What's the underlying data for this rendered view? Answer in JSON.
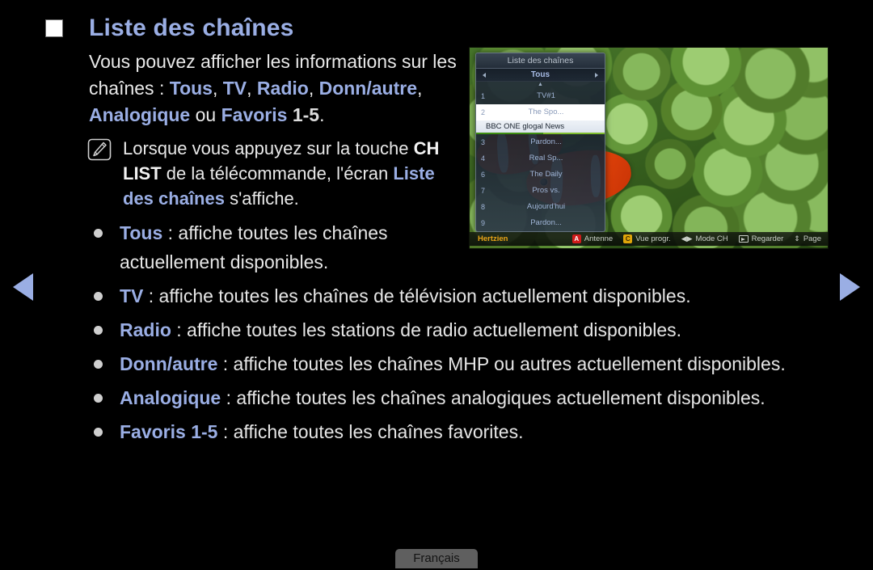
{
  "page": {
    "title": "Liste des chaînes",
    "intro": {
      "lead": "Vous pouvez afficher les informations sur les chaînes : ",
      "kw_tous": "Tous",
      "sep1": ", ",
      "kw_tv": "TV",
      "sep2": ", ",
      "kw_radio": "Radio",
      "sep3": ", ",
      "kw_donn": "Donn/autre",
      "sep4": ", ",
      "kw_analog": "Analogique",
      "sep5": " ou ",
      "kw_favoris": "Favoris",
      "kw_favoris_range": " 1-5",
      "end": "."
    },
    "note": {
      "icon": "note-pen-icon",
      "part1": "Lorsque vous appuyez sur la touche ",
      "bold1": "CH LIST",
      "part2": " de la télécommande, l'écran ",
      "bold2": "Liste des chaînes",
      "part3": " s'affiche."
    },
    "bullets": [
      {
        "term": "Tous",
        "desc": " : affiche toutes les chaînes actuellement disponibles.",
        "narrow": true
      },
      {
        "term": "TV",
        "desc": " : affiche toutes les chaînes de télévision actuellement disponibles.",
        "narrow": false
      },
      {
        "term": "Radio",
        "desc": " : affiche toutes les stations de radio actuellement disponibles.",
        "narrow": false
      },
      {
        "term": "Donn/autre",
        "desc": " : affiche toutes les chaînes MHP ou autres actuellement disponibles.",
        "narrow": false
      },
      {
        "term": "Analogique",
        "desc": " : affiche toutes les chaînes analogiques actuellement disponibles.",
        "narrow": false
      },
      {
        "term": "Favoris 1-5",
        "desc": " : affiche toutes les chaînes favorites.",
        "narrow": false
      }
    ],
    "footer": {
      "language": "Français"
    },
    "nav": {
      "prev_icon": "triangle-left-icon",
      "next_icon": "triangle-right-icon"
    }
  },
  "tv_screenshot": {
    "channel_list": {
      "header": "Liste des chaînes",
      "filter": "Tous",
      "filter_left_icon": "arrow-left-icon",
      "filter_right_icon": "arrow-right-icon",
      "scroll_up_icon": "▲",
      "scroll_down_icon": "▼",
      "rows": [
        {
          "num": "1",
          "name": "TV#1",
          "selected": false
        },
        {
          "num": "2",
          "name": "The Spo...",
          "selected": true
        },
        {
          "num": "3",
          "name": "Pardon...",
          "selected": false
        },
        {
          "num": "4",
          "name": "Real Sp...",
          "selected": false
        },
        {
          "num": "6",
          "name": "The Daily",
          "selected": false
        },
        {
          "num": "7",
          "name": "Pros vs.",
          "selected": false
        },
        {
          "num": "8",
          "name": "Aujourd'hui",
          "selected": false
        },
        {
          "num": "9",
          "name": "Pardon...",
          "selected": false
        }
      ],
      "info_row": {
        "text": "BBC ONE glogal News",
        "progress_percent": 52,
        "progress_color": "#3f8f12"
      }
    },
    "status_bar": {
      "source_label": "Hertzien",
      "items": [
        {
          "key": "A",
          "key_color": "#d01b1b",
          "glyph": "",
          "label": "Antenne"
        },
        {
          "key": "C",
          "key_color": "#e0a50a",
          "glyph": "",
          "label": "Vue progr."
        },
        {
          "key": "",
          "key_color": "",
          "glyph": "◀▶",
          "label": "Mode CH"
        },
        {
          "key": "",
          "key_color": "",
          "glyph": "enter",
          "label": "Regarder"
        },
        {
          "key": "",
          "key_color": "",
          "glyph": "⇕",
          "label": "Page"
        }
      ]
    }
  },
  "colors": {
    "accent_blue": "#9aaee4",
    "body_text": "#e6e6e6",
    "background": "#000000",
    "progress_green": "#3f8f12",
    "source_orange": "#e8a317"
  }
}
